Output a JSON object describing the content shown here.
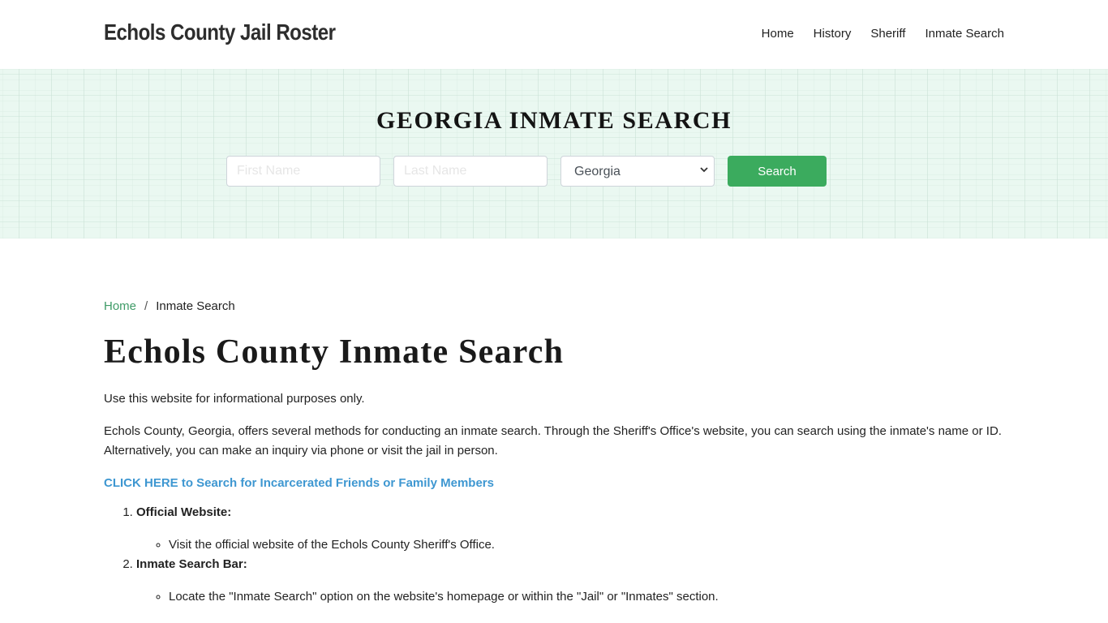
{
  "header": {
    "brand": "Echols County Jail Roster",
    "nav": [
      {
        "label": "Home"
      },
      {
        "label": "History"
      },
      {
        "label": "Sheriff"
      },
      {
        "label": "Inmate Search"
      }
    ]
  },
  "banner": {
    "title": "GEORGIA INMATE SEARCH",
    "first_name_placeholder": "First Name",
    "last_name_placeholder": "Last Name",
    "state_selected": "Georgia",
    "search_label": "Search",
    "colors": {
      "background": "#eaf8f1",
      "button": "#3bab5e"
    }
  },
  "breadcrumb": {
    "home": "Home",
    "separator": "/",
    "current": "Inmate Search"
  },
  "page": {
    "title": "Echols County Inmate Search",
    "intro": "Use this website for informational purposes only.",
    "paragraph": "Echols County, Georgia, offers several methods for conducting an inmate search. Through the Sheriff's Office's website, you can search using the inmate's name or ID. Alternatively, you can make an inquiry via phone or visit the jail in person.",
    "cta_link": "CLICK HERE to Search for Incarcerated Friends or Family Members",
    "steps": [
      {
        "title": "Official Website:",
        "bullets": [
          "Visit the official website of the Echols County Sheriff's Office."
        ]
      },
      {
        "title": "Inmate Search Bar:",
        "bullets": [
          "Locate the \"Inmate Search\" option on the website's homepage or within the \"Jail\" or \"Inmates\" section."
        ]
      }
    ]
  }
}
